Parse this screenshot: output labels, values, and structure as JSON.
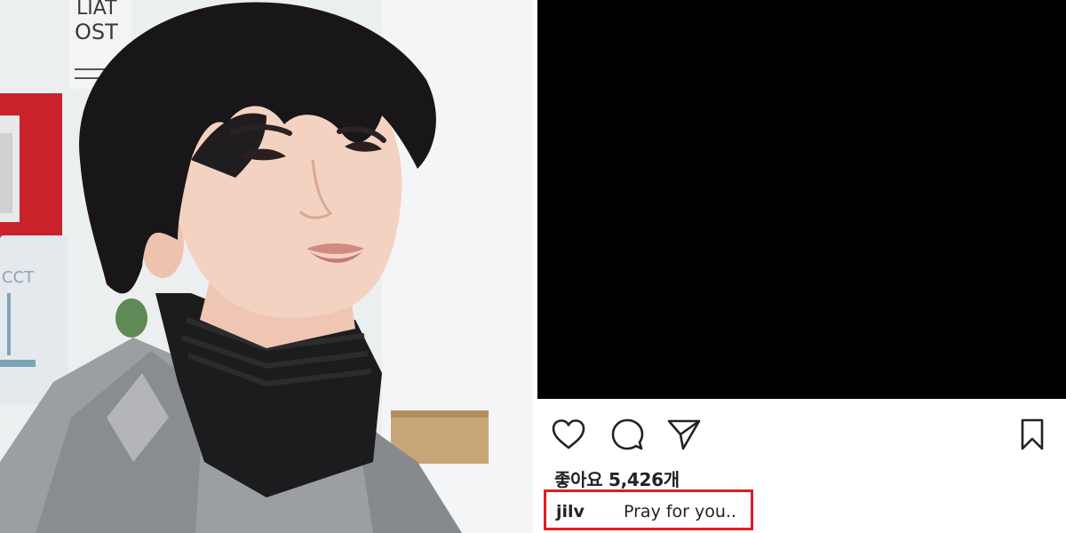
{
  "photo": {
    "sign_text_top": "LIAT",
    "sign_text_mid": "OST"
  },
  "post": {
    "likes_label": "좋아요 5,426개",
    "caption": {
      "username": "jilv",
      "text": "Pray for you.."
    },
    "highlight_color": "#e01b22",
    "media_color": "#000000"
  },
  "icons": {
    "like": "heart-icon",
    "comment": "comment-icon",
    "share": "paper-plane-icon",
    "save": "bookmark-icon"
  }
}
